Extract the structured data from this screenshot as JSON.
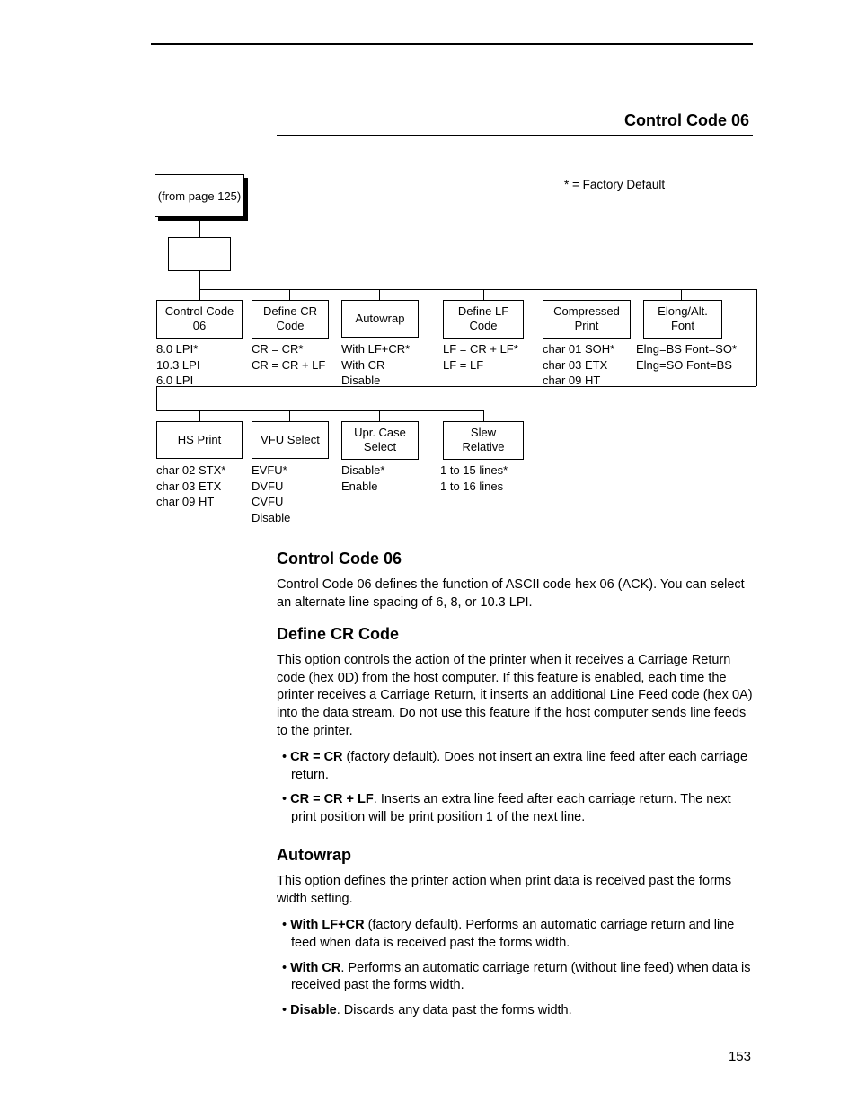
{
  "header": {
    "section_right": "Control Code 06"
  },
  "pagenum": "153",
  "legend": "* = Factory Default",
  "diagram": {
    "pagelink": "(from page 125)",
    "row1": [
      {
        "label": "Control Code\n06",
        "opts": [
          "8.0 LPI*",
          "10.3 LPI",
          "6.0 LPI"
        ]
      },
      {
        "label": "Define CR\nCode",
        "opts": [
          "CR = CR*",
          "CR = CR + LF"
        ]
      },
      {
        "label": "Autowrap",
        "opts": [
          "With LF+CR*",
          "With CR",
          "Disable"
        ]
      },
      {
        "label": "Define LF\nCode",
        "opts": [
          "LF = CR + LF*",
          "LF = LF"
        ]
      },
      {
        "label": "Compressed\nPrint",
        "opts": [
          "char 01 SOH*",
          "char 03 ETX",
          "char 09 HT"
        ]
      },
      {
        "label": "Elong/Alt.\nFont",
        "opts": [
          "Elng=BS Font=SO*",
          "Elng=SO Font=BS"
        ]
      }
    ],
    "row2": [
      {
        "label": "HS Print",
        "opts": [
          "char 02 STX*",
          "char 03 ETX",
          "char 09 HT"
        ]
      },
      {
        "label": "VFU Select",
        "opts": [
          "EVFU*",
          "DVFU",
          "CVFU",
          "Disable"
        ]
      },
      {
        "label": "Upr. Case\nSelect",
        "opts": [
          "Disable*",
          "Enable"
        ]
      },
      {
        "label": "Slew\nRelative",
        "opts": [
          "1 to 15 lines*",
          "1 to 16 lines"
        ]
      }
    ]
  },
  "sections": {
    "cc06": {
      "title": "Control Code 06",
      "p1": "Control Code 06 defines the function of ASCII code hex 06 (ACK). You can select an alternate line spacing of 6, 8, or 10.3 LPI."
    },
    "defcr": {
      "title": "Define CR Code",
      "p1": "This option controls the action of the printer when it receives a Carriage Return code (hex 0D) from the host computer. If this feature is enabled, each time the printer receives a Carriage Return, it inserts an additional Line Feed code (hex 0A) into the data stream. Do not use this feature if the host computer sends line feeds to the printer.",
      "b1_bold": "CR = CR",
      "b1_rest": " (factory default). Does not insert an extra line feed after each carriage return.",
      "b2_bold": "CR = CR + LF",
      "b2_rest": ". Inserts an extra line feed after each carriage return. The next print position will be print position 1 of the next line."
    },
    "autowrap": {
      "title": "Autowrap",
      "p1": "This option defines the printer action when print data is received past the forms width setting.",
      "b1_bold": "With LF+CR",
      "b1_rest": " (factory default). Performs an automatic carriage return and line feed when data is received past the forms width.",
      "b2_bold": "With CR",
      "b2_rest": ". Performs an automatic carriage return (without line feed) when data is received past the forms width.",
      "b3_bold": "Disable",
      "b3_rest": ". Discards any data past the forms width."
    }
  }
}
